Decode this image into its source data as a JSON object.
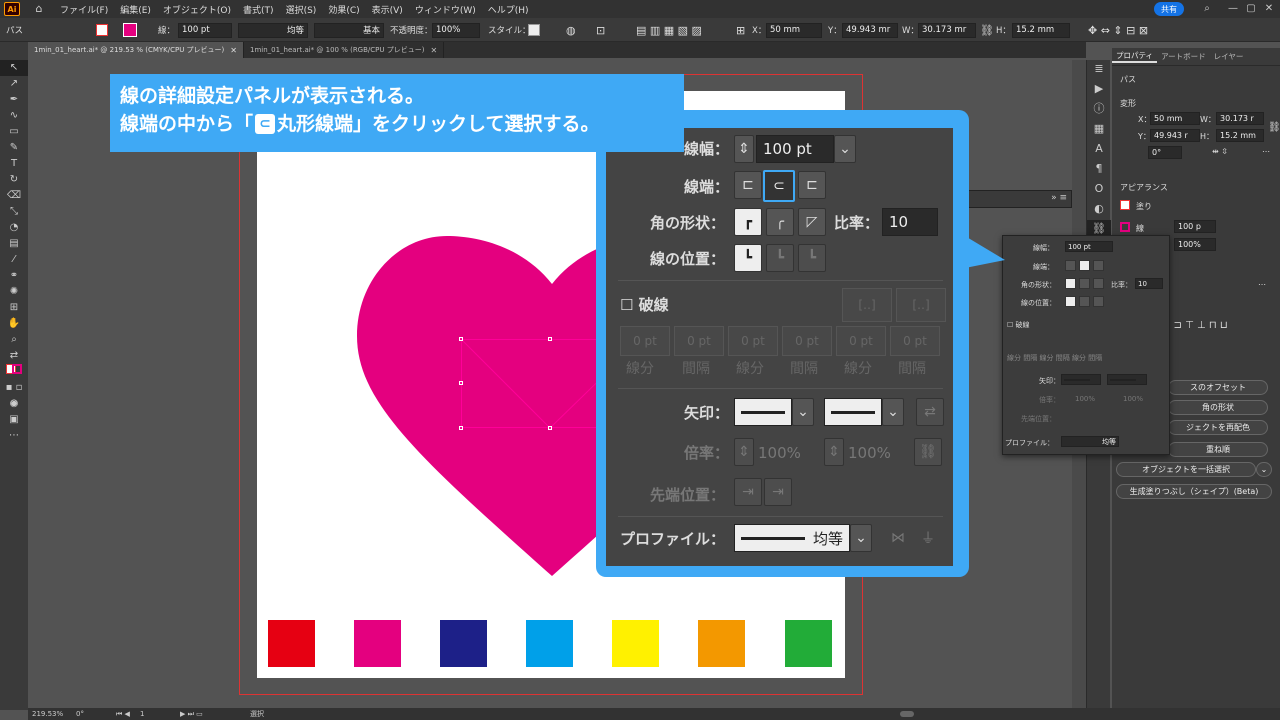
{
  "menubar": {
    "logo": "Ai",
    "items": [
      "ファイル(F)",
      "編集(E)",
      "オブジェクト(O)",
      "書式(T)",
      "選択(S)",
      "効果(C)",
      "表示(V)",
      "ウィンドウ(W)",
      "ヘルプ(H)"
    ],
    "share_label": "共有"
  },
  "controlbar": {
    "object_type": "パス",
    "stroke_label": "線：",
    "stroke_weight": "100 pt",
    "stroke_profile": "均等",
    "brush": "基本",
    "opacity_label": "不透明度：",
    "opacity": "100%",
    "style_label": "スタイル：",
    "x_label": "X：",
    "x": "50 mm",
    "y_label": "Y：",
    "y": "49.943 mr",
    "w_label": "W：",
    "w": "30.173 mr",
    "h_label": "H：",
    "h": "15.2 mm"
  },
  "tabs": [
    {
      "label": "1min_01_heart.ai* @ 219.53 % (CMYK/CPU プレビュー)",
      "active": true
    },
    {
      "label": "1min_01_heart.ai* @ 100 % (RGB/CPU プレビュー)",
      "active": false
    }
  ],
  "callout": {
    "line1": "線の詳細設定パネルが表示される。",
    "line2_before": "線端の中から「",
    "line2_after": "丸形線端」をクリックして選択する。"
  },
  "stroke_panel_zoom": {
    "weight_label": "線幅：",
    "weight": "100 pt",
    "cap_label": "線端：",
    "corner_label": "角の形状：",
    "limit_label": "比率：",
    "limit": "10",
    "align_label": "線の位置：",
    "dashed_label": "破線",
    "dash_values": [
      "0 pt",
      "0 pt",
      "0 pt",
      "0 pt",
      "0 pt",
      "0 pt"
    ],
    "dash_labels": [
      "線分",
      "間隔",
      "線分",
      "間隔",
      "線分",
      "間隔"
    ],
    "arrow_label": "矢印：",
    "scale_label": "倍率：",
    "scale1": "100%",
    "scale2": "100%",
    "tip_label": "先端位置：",
    "profile_label": "プロファイル：",
    "profile": "均等"
  },
  "stroke_panel_small": {
    "weight_label": "線幅：",
    "weight": "100 pt",
    "cap_label": "線端：",
    "corner_label": "角の形状：",
    "limit_label": "比率：",
    "limit": "10",
    "align_label": "線の位置：",
    "dashed_label": "破線",
    "dash_labels": [
      "線分",
      "間隔",
      "線分",
      "間隔",
      "線分",
      "間隔"
    ],
    "arrow_label": "矢印：",
    "scale_label": "倍率：",
    "scale1": "100%",
    "scale2": "100%",
    "tip_label": "先端位置：",
    "profile_label": "プロファイル：",
    "profile": "均等"
  },
  "properties": {
    "tabs": [
      "プロパティ",
      "アートボード",
      "レイヤー"
    ],
    "object_type": "パス",
    "transform_label": "変形",
    "x_label": "X：",
    "x": "50 mm",
    "y_label": "Y：",
    "y": "49.943 r",
    "w_label": "W：",
    "w": "30.173 r",
    "h_label": "H：",
    "h": "15.2 mm",
    "angle": "0°",
    "appearance_label": "アピアランス",
    "fill_label": "塗り",
    "stroke_label": "線",
    "stroke_weight": "100 p",
    "opacity": "100%",
    "btn_offset": "スのオフセット",
    "btn_corner": "角の形状",
    "btn_recolor": "ジェクトを再配色",
    "btn_stack": "重ね順",
    "btn_select_same": "オブジェクトを一括選択",
    "btn_generative": "生成塗りつぶし（シェイプ）(Beta)"
  },
  "status": {
    "zoom": "219.53%",
    "angle": "0°",
    "artboard": "1",
    "mode": "選択"
  },
  "colors": {
    "heart": "#e4007f",
    "swatches": [
      "#e60012",
      "#e4007f",
      "#1d2088",
      "#00a0e9",
      "#fff100",
      "#f39800",
      "#22ac38"
    ],
    "callout": "#3fa9f5"
  }
}
